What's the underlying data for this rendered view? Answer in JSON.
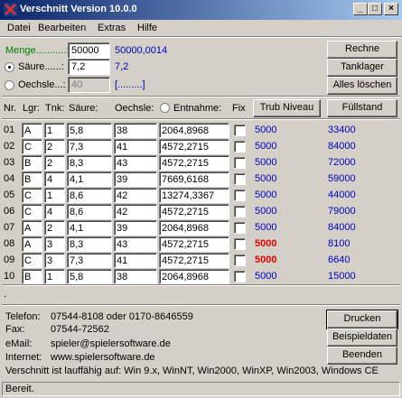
{
  "window": {
    "title": "Verschnitt Version 10.0.0",
    "min": "_",
    "max": "□",
    "close": "×"
  },
  "menu": [
    "Datei",
    "Bearbeiten",
    "Extras",
    "Hilfe"
  ],
  "inputs": {
    "menge_label": "Menge...........:",
    "menge_value": "50000",
    "menge_result": "50000,0014",
    "saeure_label": "Säure......:",
    "saeure_value": "7,2",
    "saeure_result": "7,2",
    "oechsle_label": "Oechsle...:",
    "oechsle_value": "40",
    "oechsle_result": "[.........]"
  },
  "buttons": {
    "rechne": "Rechne",
    "tanklager": "Tanklager",
    "alles_loeschen": "Alles löschen",
    "trub_niveau": "Trub Niveau",
    "fuellstand": "Füllstand",
    "drucken": "Drucken",
    "beispieldaten": "Beispieldaten",
    "beenden": "Beenden"
  },
  "table": {
    "headers": {
      "nr": "Nr.",
      "lgr": "Lgr:",
      "tnk": "Tnk:",
      "saeure": "Säure:",
      "oechsle": "Oechsle:",
      "entnahme": "Entnahme:",
      "fix": "Fix"
    },
    "rows": [
      {
        "nr": "01",
        "lgr": "A",
        "tnk": "1",
        "saeure": "5,8",
        "oechsle": "38",
        "entnahme": "2064,8968",
        "r1": "5000",
        "r2": "33400",
        "hi": false
      },
      {
        "nr": "02",
        "lgr": "C",
        "tnk": "2",
        "saeure": "7,3",
        "oechsle": "41",
        "entnahme": "4572,2715",
        "r1": "5000",
        "r2": "84000",
        "hi": false
      },
      {
        "nr": "03",
        "lgr": "B",
        "tnk": "2",
        "saeure": "8,3",
        "oechsle": "43",
        "entnahme": "4572,2715",
        "r1": "5000",
        "r2": "72000",
        "hi": false
      },
      {
        "nr": "04",
        "lgr": "B",
        "tnk": "4",
        "saeure": "4,1",
        "oechsle": "39",
        "entnahme": "7669,6168",
        "r1": "5000",
        "r2": "59000",
        "hi": false
      },
      {
        "nr": "05",
        "lgr": "C",
        "tnk": "1",
        "saeure": "8,6",
        "oechsle": "42",
        "entnahme": "13274,3367",
        "r1": "5000",
        "r2": "44000",
        "hi": false
      },
      {
        "nr": "06",
        "lgr": "C",
        "tnk": "4",
        "saeure": "8,6",
        "oechsle": "42",
        "entnahme": "4572,2715",
        "r1": "5000",
        "r2": "79000",
        "hi": false
      },
      {
        "nr": "07",
        "lgr": "A",
        "tnk": "2",
        "saeure": "4,1",
        "oechsle": "39",
        "entnahme": "2064,8968",
        "r1": "5000",
        "r2": "84000",
        "hi": false
      },
      {
        "nr": "08",
        "lgr": "A",
        "tnk": "3",
        "saeure": "8,3",
        "oechsle": "43",
        "entnahme": "4572,2715",
        "r1": "5000",
        "r2": "8100",
        "hi": true
      },
      {
        "nr": "09",
        "lgr": "C",
        "tnk": "3",
        "saeure": "7,3",
        "oechsle": "41",
        "entnahme": "4572,2715",
        "r1": "5000",
        "r2": "6640",
        "hi": true
      },
      {
        "nr": "10",
        "lgr": "B",
        "tnk": "1",
        "saeure": "5,8",
        "oechsle": "38",
        "entnahme": "2064,8968",
        "r1": "5000",
        "r2": "15000",
        "hi": false
      }
    ]
  },
  "dot": ".",
  "contact": {
    "telefon_label": "Telefon:",
    "telefon": "07544-8108 oder 0170-8646559",
    "fax_label": "Fax:",
    "fax": "07544-72562",
    "email_label": "eMail:",
    "email": "spieler@spielersoftware.de",
    "internet_label": "Internet:",
    "internet": "www.spielersoftware.de",
    "compat": "Verschnitt ist lauffähig auf: Win 9.x, WinNT, Win2000, WinXP, Win2003, Windows CE"
  },
  "status": "Bereit.",
  "colors": {
    "accent_blue": "#0000c0",
    "alert_red": "#e00000",
    "menge_green": "#008000",
    "titlebar": "#0a246a"
  }
}
